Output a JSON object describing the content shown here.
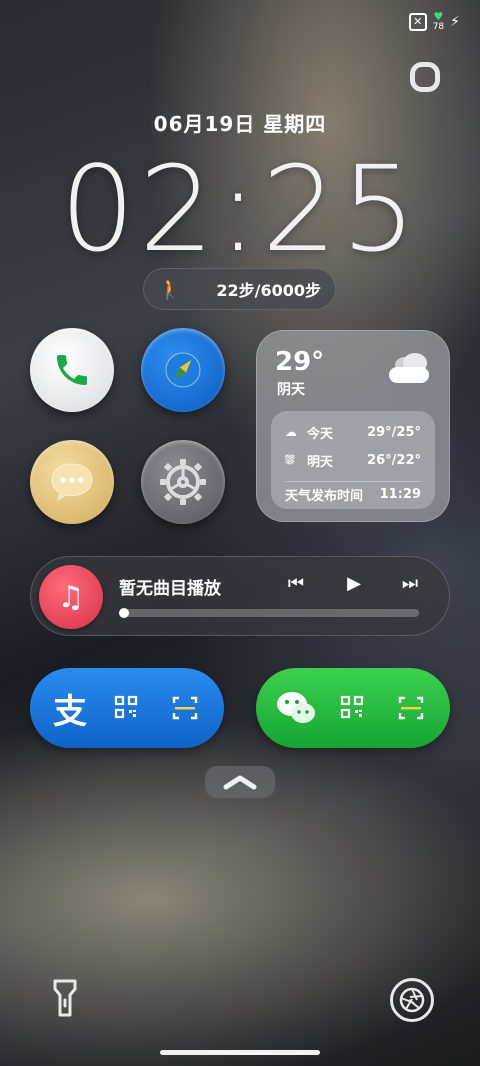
{
  "status": {
    "battery_level": "78",
    "icons": [
      "x-box-icon",
      "battery-heart-icon",
      "charging-bolt-icon"
    ]
  },
  "lock": {
    "date": "06月19日 星期四",
    "time": "02:25"
  },
  "steps": {
    "count": "22步/6000步"
  },
  "weather": {
    "temp": "29°",
    "condition": "阴天",
    "forecast": [
      {
        "icon": "cloud-icon",
        "day": "今天",
        "range": "29°/25°"
      },
      {
        "icon": "rain-cloud-icon",
        "day": "明天",
        "range": "26°/22°"
      }
    ],
    "publish_label": "天气发布时间",
    "publish_time": "11:29"
  },
  "music": {
    "title": "暂无曲目播放",
    "progress": 0.0
  },
  "pay": {
    "alipay_char": "支"
  },
  "colors": {
    "alipay": "#1677ff",
    "wechat": "#07c160",
    "music_icon": "#e8394f"
  }
}
